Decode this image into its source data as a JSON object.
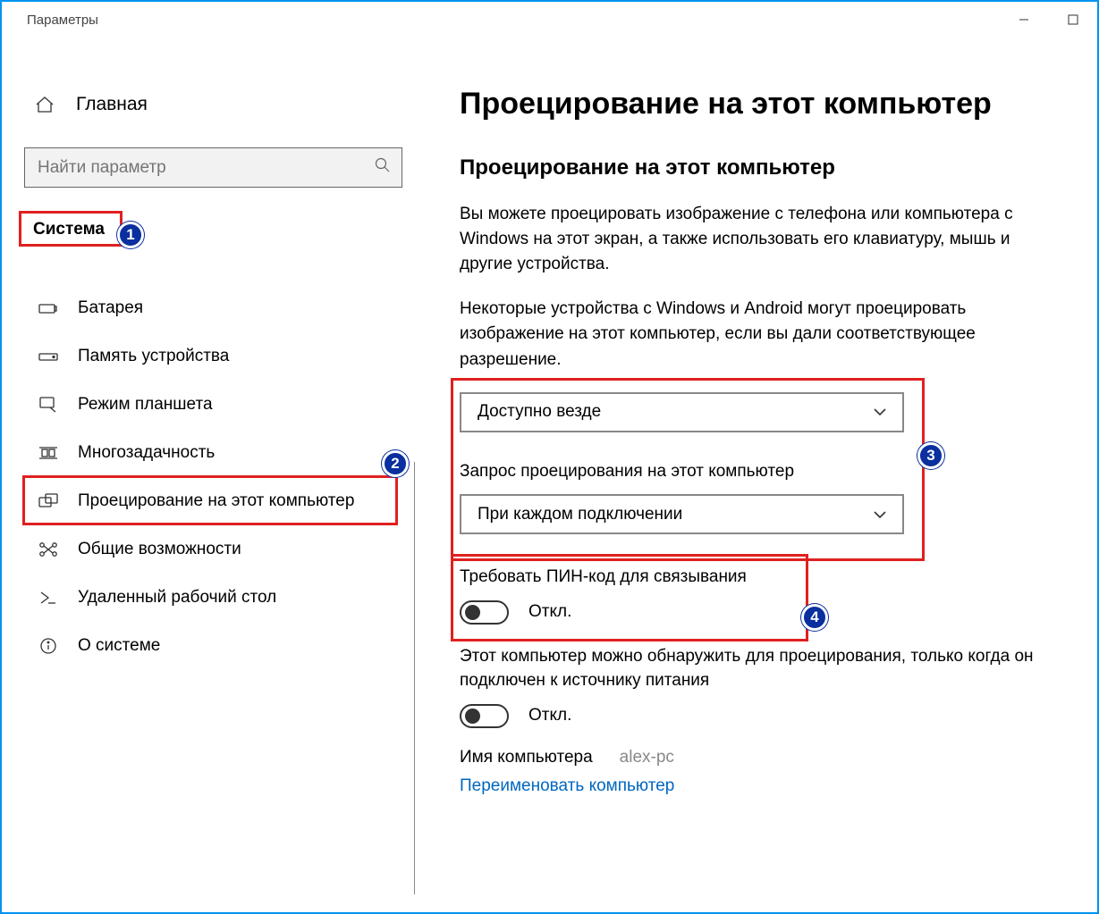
{
  "window": {
    "title": "Параметры"
  },
  "sidebar": {
    "home": "Главная",
    "search_placeholder": "Найти параметр",
    "section": "Система",
    "items": [
      {
        "label": "Батарея"
      },
      {
        "label": "Память устройства"
      },
      {
        "label": "Режим планшета"
      },
      {
        "label": "Многозадачность"
      },
      {
        "label": "Проецирование на этот компьютер"
      },
      {
        "label": "Общие возможности"
      },
      {
        "label": "Удаленный рабочий стол"
      },
      {
        "label": "О системе"
      }
    ]
  },
  "main": {
    "title": "Проецирование на этот компьютер",
    "section_heading": "Проецирование на этот компьютер",
    "desc1": "Вы можете проецировать изображение с телефона или компьютера с Windows на этот экран, а также использовать его клавиатуру, мышь и другие устройства.",
    "desc2": "Некоторые устройства с Windows и Android могут проецировать изображение на этот компьютер, если вы дали соответствующее разрешение.",
    "availability_value": "Доступно везде",
    "ask_label": "Запрос проецирования на этот компьютер",
    "ask_value": "При каждом подключении",
    "pin_label": "Требовать ПИН-код для связывания",
    "pin_state": "Откл.",
    "power_label": "Этот компьютер можно обнаружить для проецирования, только когда он подключен к источнику питания",
    "power_state": "Откл.",
    "pc_name_label": "Имя компьютера",
    "pc_name_value": "alex-pc",
    "rename_link": "Переименовать компьютер"
  },
  "annotations": {
    "b1": "1",
    "b2": "2",
    "b3": "3",
    "b4": "4"
  }
}
